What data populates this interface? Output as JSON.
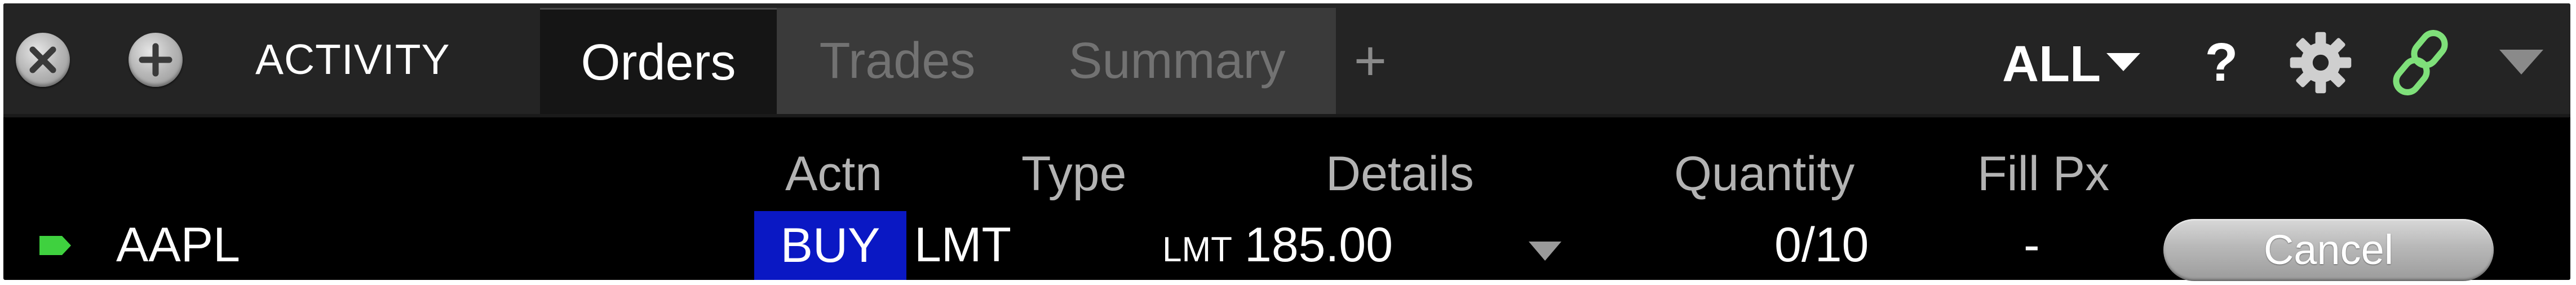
{
  "toolbar": {
    "close_icon": "close-x-icon",
    "add_icon": "add-plus-icon",
    "title": "ACTIVITY"
  },
  "tabs": [
    {
      "label": "Orders",
      "active": true
    },
    {
      "label": "Trades",
      "active": false
    },
    {
      "label": "Summary",
      "active": false
    }
  ],
  "tab_add": "+",
  "filter": {
    "label": "ALL"
  },
  "help": "?",
  "icons": {
    "settings": "gear-icon",
    "link": "link-icon",
    "menu": "chevron-down-icon"
  },
  "colors": {
    "link_icon": "#7fe07a",
    "buy_background": "#0a18c4",
    "flag": "#3fd13f"
  },
  "columns": [
    "Actn",
    "Type",
    "Details",
    "Quantity",
    "Fill Px"
  ],
  "order": {
    "symbol": "AAPL",
    "action": "BUY",
    "type": "LMT",
    "details_type": "LMT",
    "details_price": "185.00",
    "quantity": "0/10",
    "fill_px": "-",
    "cancel_label": "Cancel"
  }
}
